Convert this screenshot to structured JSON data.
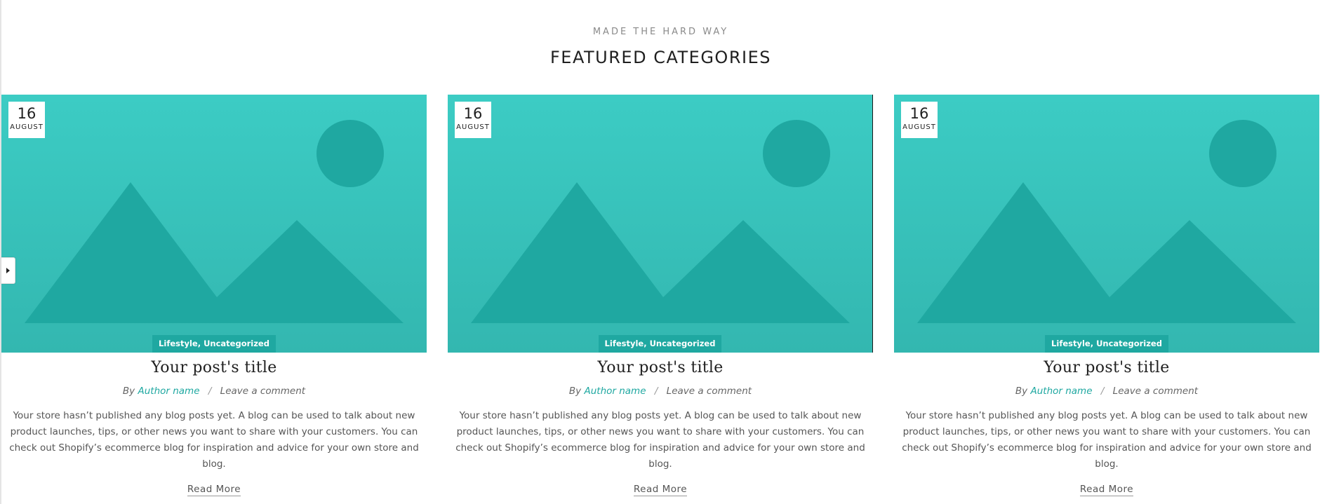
{
  "header": {
    "eyebrow": "MADE THE HARD WAY",
    "title": "FEATURED CATEGORIES"
  },
  "colors": {
    "accent": "#1fa8a1",
    "image_background": "#3cccc4",
    "image_shapes": "#1fa8a1"
  },
  "posts": [
    {
      "date_day": "16",
      "date_month": "AUGUST",
      "categories": "Lifestyle, Uncategorized",
      "title": "Your post's title",
      "by": "By",
      "author": "Author name",
      "separator": "/",
      "comment_link": "Leave a comment",
      "excerpt": "Your store hasn’t published any blog posts yet. A blog can be used to talk about new product launches, tips, or other news you want to share with your customers. You can check out Shopify’s ecommerce blog for inspiration and advice for your own store and blog.",
      "read_more": "Read More",
      "image_icon": "image-placeholder-icon"
    },
    {
      "date_day": "16",
      "date_month": "AUGUST",
      "categories": "Lifestyle, Uncategorized",
      "title": "Your post's title",
      "by": "By",
      "author": "Author name",
      "separator": "/",
      "comment_link": "Leave a comment",
      "excerpt": "Your store hasn’t published any blog posts yet. A blog can be used to talk about new product launches, tips, or other news you want to share with your customers. You can check out Shopify’s ecommerce blog for inspiration and advice for your own store and blog.",
      "read_more": "Read More",
      "image_icon": "image-placeholder-icon"
    },
    {
      "date_day": "16",
      "date_month": "AUGUST",
      "categories": "Lifestyle, Uncategorized",
      "title": "Your post's title",
      "by": "By",
      "author": "Author name",
      "separator": "/",
      "comment_link": "Leave a comment",
      "excerpt": "Your store hasn’t published any blog posts yet. A blog can be used to talk about new product launches, tips, or other news you want to share with your customers. You can check out Shopify’s ecommerce blog for inspiration and advice for your own store and blog.",
      "read_more": "Read More",
      "image_icon": "image-placeholder-icon"
    }
  ],
  "slider": {
    "arrow_icon": "caret-right-icon"
  }
}
